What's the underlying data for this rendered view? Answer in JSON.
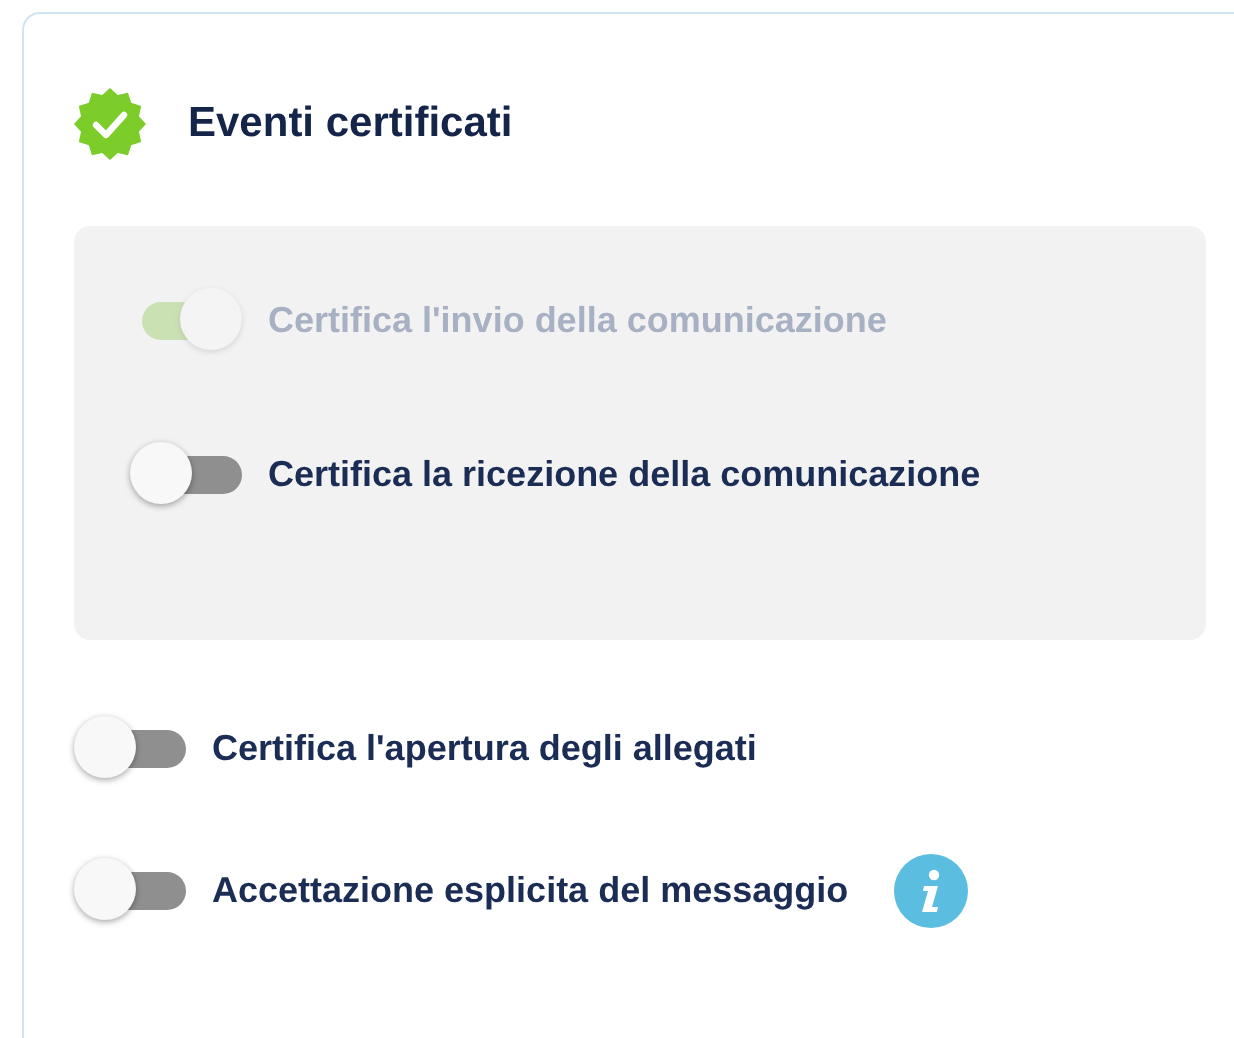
{
  "card": {
    "title": "Eventi certificati"
  },
  "panel_toggles": [
    {
      "label": "Certifica l'invio della comunicazione",
      "on": true,
      "disabled": true,
      "info": false
    },
    {
      "label": "Certifica la ricezione della comunicazione",
      "on": false,
      "disabled": false,
      "info": false
    }
  ],
  "toggles": [
    {
      "label": "Certifica l'apertura degli allegati",
      "on": false,
      "disabled": false,
      "info": false
    },
    {
      "label": "Accettazione esplicita del messaggio",
      "on": false,
      "disabled": false,
      "info": true
    }
  ]
}
